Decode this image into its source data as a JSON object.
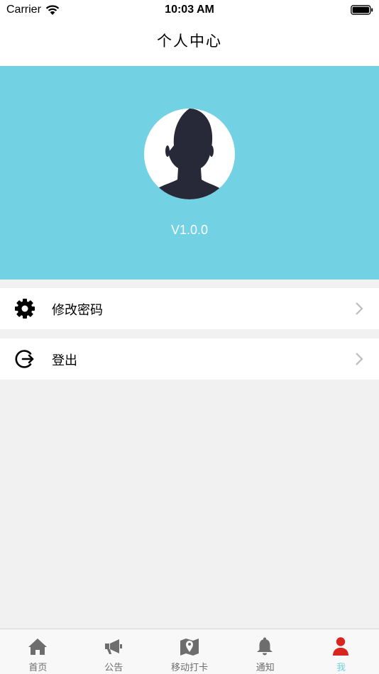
{
  "status_bar": {
    "carrier": "Carrier",
    "time": "10:03 AM"
  },
  "nav": {
    "title": "个人中心"
  },
  "profile": {
    "version": "V1.0.0"
  },
  "menu": [
    {
      "label": "修改密码",
      "icon": "gear-icon"
    },
    {
      "label": "登出",
      "icon": "logout-icon"
    }
  ],
  "tabs": [
    {
      "label": "首页",
      "icon": "home-icon"
    },
    {
      "label": "公告",
      "icon": "megaphone-icon"
    },
    {
      "label": "移动打卡",
      "icon": "map-pin-icon"
    },
    {
      "label": "通知",
      "icon": "bell-icon"
    },
    {
      "label": "我",
      "icon": "person-icon",
      "active": true
    }
  ],
  "colors": {
    "accent": "#72d1e3",
    "background": "#f1f1f1",
    "tab_icon": "#6d6d6d",
    "active_tab_icon": "#d9251d",
    "avatar_silhouette": "#272838"
  }
}
